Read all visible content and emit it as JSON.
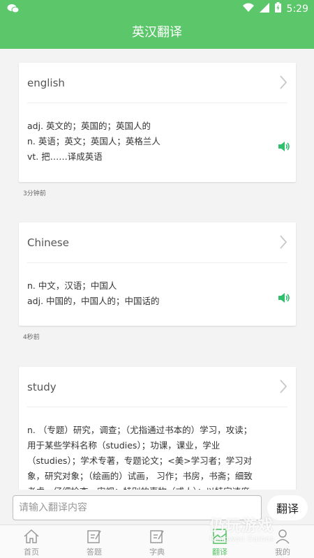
{
  "status": {
    "time": "5:29"
  },
  "app": {
    "title": "英汉翻译"
  },
  "colors": {
    "accent": "#5bc66a"
  },
  "history": [
    {
      "word": "english",
      "definitions": [
        "adj. 英文的；英国的；英国人的",
        "n. 英语；英文；英国人；英格兰人",
        "vt. 把……译成英语"
      ],
      "time": "3分钟前"
    },
    {
      "word": "Chinese",
      "definitions": [
        "n. 中文，汉语；中国人",
        "adj. 中国的，中国人的；中国话的"
      ],
      "time": "4秒前"
    },
    {
      "word": "study",
      "definitions": [
        "n. （专题）研究，调查；（尤指通过书本的）学习，攻读；",
        "用于某些学科名称（studies）；功课，课业，学业",
        "（studies）；学术专著，专题论文；<美>学习者；学习对",
        "象，研究对象；（绘画的）试画， 习作；书房，书斋；细致",
        "考虑，仔细检查，审视；特别的事物（或人）；以特定速度"
      ]
    }
  ],
  "input": {
    "placeholder": "请输入翻译内容",
    "button_label": "翻译"
  },
  "tabs": [
    {
      "label": "首页",
      "icon": "home-icon"
    },
    {
      "label": "答题",
      "icon": "edit-icon"
    },
    {
      "label": "字典",
      "icon": "edit-icon"
    },
    {
      "label": "翻译",
      "icon": "translate-icon",
      "active": true
    },
    {
      "label": "我的",
      "icon": "user-icon"
    }
  ],
  "watermark": {
    "text": "仍玩游戏",
    "sub": "Rengwan Games"
  }
}
